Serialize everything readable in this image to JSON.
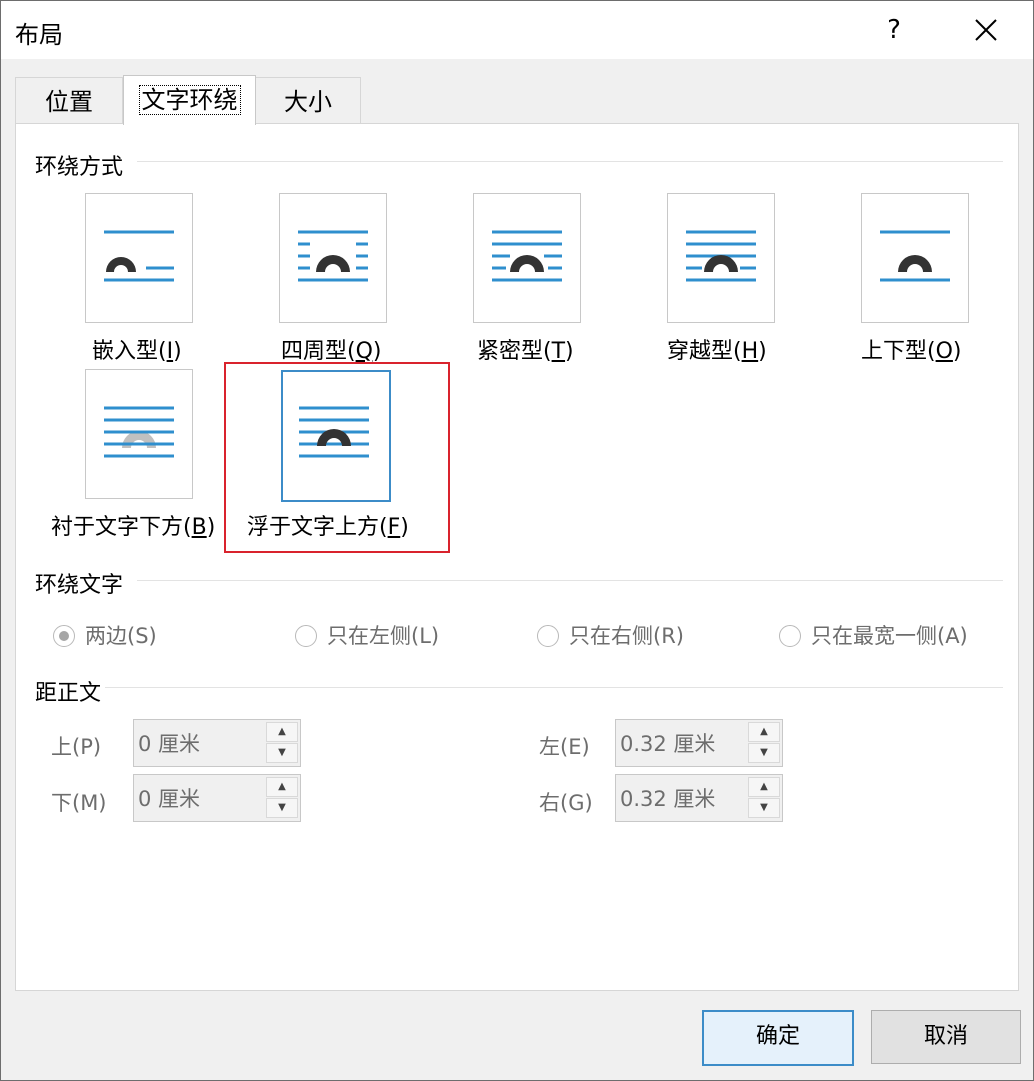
{
  "window": {
    "title": "布局",
    "help": "?"
  },
  "tabs": [
    {
      "label": "位置",
      "active": false
    },
    {
      "label": "文字环绕",
      "active": true
    },
    {
      "label": "大小",
      "active": false
    }
  ],
  "wrap_style": {
    "heading": "环绕方式",
    "options": [
      {
        "label": "嵌入型(",
        "key": "I",
        "tail": ")"
      },
      {
        "label": "四周型(",
        "key": "Q",
        "tail": ")"
      },
      {
        "label": "紧密型(",
        "key": "T",
        "tail": ")"
      },
      {
        "label": "穿越型(",
        "key": "H",
        "tail": ")"
      },
      {
        "label": "上下型(",
        "key": "O",
        "tail": ")"
      },
      {
        "label": "衬于文字下方(",
        "key": "B",
        "tail": ")"
      },
      {
        "label": "浮于文字上方(",
        "key": "F",
        "tail": ")"
      }
    ],
    "selected_index": 6
  },
  "wrap_text": {
    "heading": "环绕文字",
    "options": [
      "两边(S)",
      "只在左侧(L)",
      "只在右侧(R)",
      "只在最宽一侧(A)"
    ],
    "selected_index": 0
  },
  "distance": {
    "heading": "距正文",
    "top": {
      "label": "上(P)",
      "value": "0 厘米"
    },
    "bottom": {
      "label": "下(M)",
      "value": "0 厘米"
    },
    "left": {
      "label": "左(E)",
      "value": "0.32 厘米"
    },
    "right": {
      "label": "右(G)",
      "value": "0.32 厘米"
    }
  },
  "buttons": {
    "ok": "确定",
    "cancel": "取消"
  },
  "colors": {
    "accent": "#3c8cc8",
    "highlight": "#d9232d",
    "line": "#2f8fce"
  }
}
